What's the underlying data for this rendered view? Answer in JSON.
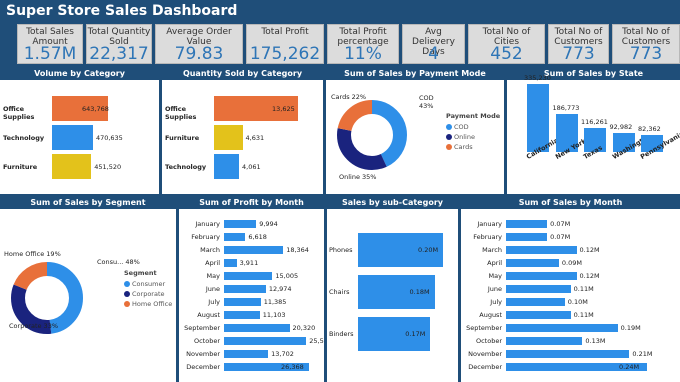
{
  "title": "Super Store Sales Dashboard",
  "kpis": [
    {
      "label": "Total Sales Amount",
      "value": "1.57M"
    },
    {
      "label": "Total Quantity Sold",
      "value": "22,317"
    },
    {
      "label": "Average Order Value",
      "value": "79.83"
    },
    {
      "label": "Total Profit",
      "value": "175,262"
    },
    {
      "label": "Total Profit percentage",
      "value": "11%"
    },
    {
      "label": "Avg Delievery Days",
      "value": "4"
    },
    {
      "label": "Total No of Cities",
      "value": "452"
    },
    {
      "label": "Total No of Customers",
      "value": "773"
    },
    {
      "label": "Total No of Customers",
      "value": "773"
    }
  ],
  "panels": {
    "volume": {
      "title": "Volume by Category"
    },
    "qty": {
      "title": "Quantity Sold by Category"
    },
    "payment": {
      "title": "Sum of Sales by Payment Mode"
    },
    "state": {
      "title": "Sum of Sales by State"
    },
    "segment": {
      "title": "Sum of Sales by Segment"
    },
    "profit": {
      "title": "Sum of Profit by Month"
    },
    "subcat": {
      "title": "Sales by sub-Category"
    },
    "salesmonth": {
      "title": "Sum of Sales by Month"
    }
  },
  "chart_data": [
    {
      "type": "bar",
      "title": "Volume by Category",
      "categories": [
        "Office Supplies",
        "Technology",
        "Furniture"
      ],
      "values": [
        643768,
        470635,
        451520
      ],
      "labels": [
        "643,768",
        "470,635",
        "451,520"
      ],
      "colors": [
        "#e8703a",
        "#2e8fe8",
        "#e3c21b"
      ]
    },
    {
      "type": "bar",
      "title": "Quantity Sold by Category",
      "categories": [
        "Office Supplies",
        "Furniture",
        "Technology"
      ],
      "values": [
        13625,
        4631,
        4061
      ],
      "labels": [
        "13,625",
        "4,631",
        "4,061"
      ],
      "colors": [
        "#e8703a",
        "#e3c21b",
        "#2e8fe8"
      ]
    },
    {
      "type": "pie",
      "title": "Sum of Sales by Payment Mode",
      "legend_title": "Payment Mode",
      "slices": [
        {
          "name": "COD",
          "pct": 43,
          "label": "COD\n43%",
          "color": "#2e8fe8"
        },
        {
          "name": "Online",
          "pct": 35,
          "label": "Online 35%",
          "color": "#1a237e"
        },
        {
          "name": "Cards",
          "pct": 22,
          "label": "Cards 22%",
          "color": "#e8703a"
        }
      ]
    },
    {
      "type": "bar",
      "title": "Sum of Sales by State",
      "categories": [
        "California",
        "New York",
        "Texas",
        "Washington",
        "Pennsylvania"
      ],
      "values": [
        335230,
        186773,
        116261,
        92982,
        82362
      ],
      "labels": [
        "335,230",
        "186,773",
        "116,261",
        "92,982",
        "82,362"
      ],
      "color": "#2e8fe8"
    },
    {
      "type": "pie",
      "title": "Sum of Sales by Segment",
      "legend_title": "Segment",
      "slices": [
        {
          "name": "Consumer",
          "pct": 48,
          "label": "Consu... 48%",
          "color": "#2e8fe8"
        },
        {
          "name": "Corporate",
          "pct": 33,
          "label": "Corporate 33%",
          "color": "#1a237e"
        },
        {
          "name": "Home Office",
          "pct": 19,
          "label": "Home Office 19%",
          "color": "#e8703a"
        }
      ]
    },
    {
      "type": "bar",
      "title": "Sum of Profit by Month",
      "categories": [
        "January",
        "February",
        "March",
        "April",
        "May",
        "June",
        "July",
        "August",
        "September",
        "October",
        "November",
        "December"
      ],
      "values": [
        9994,
        6618,
        18364,
        3911,
        15005,
        12974,
        11385,
        11103,
        20320,
        25518,
        13702,
        26368
      ],
      "labels": [
        "9,994",
        "6,618",
        "18,364",
        "3,911",
        "15,005",
        "12,974",
        "11,385",
        "11,103",
        "20,320",
        "25,518",
        "13,702",
        "26,368"
      ],
      "color": "#2e8fe8"
    },
    {
      "type": "bar",
      "title": "Sales by sub-Category",
      "categories": [
        "Phones",
        "Chairs",
        "Binders"
      ],
      "values": [
        0.2,
        0.18,
        0.17
      ],
      "labels": [
        "0.20M",
        "0.18M",
        "0.17M"
      ],
      "color": "#2e8fe8"
    },
    {
      "type": "bar",
      "title": "Sum of Sales by Month",
      "categories": [
        "January",
        "February",
        "March",
        "April",
        "May",
        "June",
        "July",
        "August",
        "September",
        "October",
        "November",
        "December"
      ],
      "values": [
        0.07,
        0.07,
        0.12,
        0.09,
        0.12,
        0.11,
        0.1,
        0.11,
        0.19,
        0.13,
        0.21,
        0.24
      ],
      "labels": [
        "0.07M",
        "0.07M",
        "0.12M",
        "0.09M",
        "0.12M",
        "0.11M",
        "0.10M",
        "0.11M",
        "0.19M",
        "0.13M",
        "0.21M",
        "0.24M"
      ],
      "color": "#2e8fe8"
    }
  ]
}
